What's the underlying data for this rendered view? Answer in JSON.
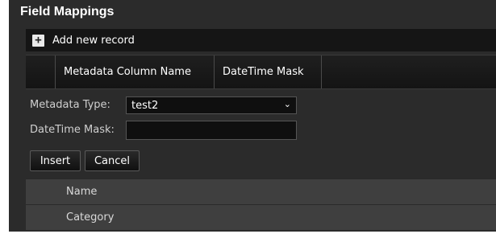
{
  "header": {
    "title": "Field Mappings"
  },
  "toolbar": {
    "add_label": "Add new record",
    "add_icon": "plus-icon"
  },
  "grid": {
    "columns": [
      "",
      "Metadata Column Name",
      "DateTime Mask",
      ""
    ]
  },
  "form": {
    "metadata_type_label": "Metadata Type:",
    "metadata_type_value": "test2",
    "datetime_mask_label": "DateTime Mask:",
    "datetime_mask_value": "",
    "insert_label": "Insert",
    "cancel_label": "Cancel"
  },
  "rows": [
    {
      "label": "Name"
    },
    {
      "label": "Category"
    }
  ],
  "colors": {
    "background": "#2b2b2b",
    "toolbar": "#151515",
    "row": "#3f3f3f",
    "text": "#ffffff"
  }
}
